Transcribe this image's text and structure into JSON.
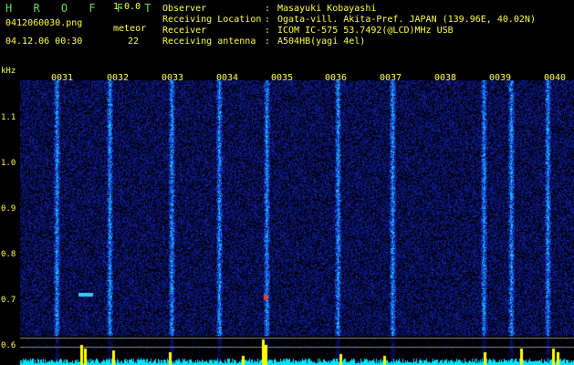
{
  "app": {
    "title": "H R O F F T",
    "version": "1.0.0"
  },
  "file": {
    "name": "0412060030.png",
    "datetime": "04.12.06 00:30"
  },
  "meteor": {
    "label": "meteor",
    "count": "22"
  },
  "info": [
    {
      "key": "Observer",
      "sep": ":",
      "value": "Masayuki Kobayashi"
    },
    {
      "key": "Receiving Location",
      "sep": ":",
      "value": "Ogata-vill. Akita-Pref. JAPAN (139.96E, 40.02N)"
    },
    {
      "key": "Receiver",
      "sep": ":",
      "value": "ICOM IC-575 53.7492(@LCD)MHz USB"
    },
    {
      "key": "Receiving antenna",
      "sep": ":",
      "value": "A504HB(yagi 4el)"
    }
  ],
  "axis": {
    "unit": "kHz",
    "yticks": [
      "1.1",
      "1.0",
      "0.9",
      "0.8",
      "0.7",
      "0.6"
    ],
    "xticks": [
      "0031",
      "0032",
      "0033",
      "0034",
      "0035",
      "0036",
      "0037",
      "0038",
      "0039",
      "0040"
    ]
  },
  "colors": {
    "label": "#ffff44",
    "title": "#5fdc5f",
    "background": "#000000",
    "noise_low": "#0a1a7a",
    "noise_high": "#00e0ff",
    "meteor_bar": "#ffff00"
  }
}
